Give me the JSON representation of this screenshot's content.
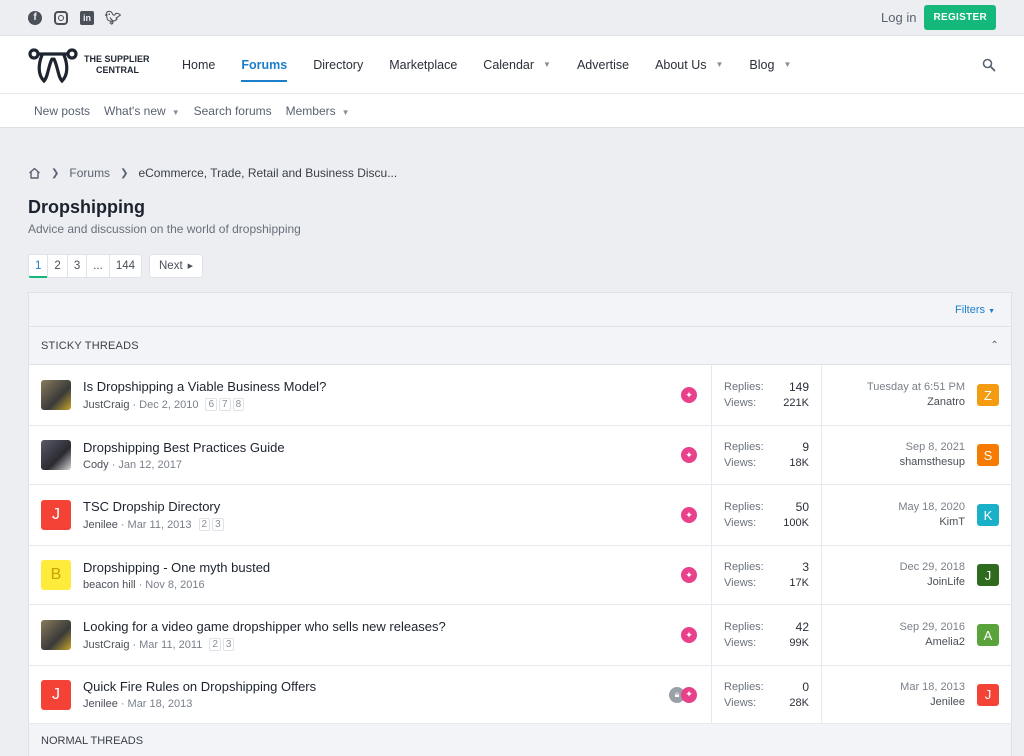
{
  "topbar": {
    "login": "Log in",
    "register": "REGISTER"
  },
  "logo": {
    "line1": "THE SUPPLIER",
    "line2": "CENTRAL"
  },
  "nav": [
    {
      "label": "Home"
    },
    {
      "label": "Forums"
    },
    {
      "label": "Directory"
    },
    {
      "label": "Marketplace"
    },
    {
      "label": "Calendar"
    },
    {
      "label": "Advertise"
    },
    {
      "label": "About Us"
    },
    {
      "label": "Blog"
    }
  ],
  "subnav": [
    {
      "label": "New posts"
    },
    {
      "label": "What's new"
    },
    {
      "label": "Search forums"
    },
    {
      "label": "Members"
    }
  ],
  "breadcrumb": {
    "forums": "Forums",
    "current": "eCommerce, Trade, Retail and Business Discu..."
  },
  "page": {
    "title": "Dropshipping",
    "description": "Advice and discussion on the world of dropshipping"
  },
  "pagination": {
    "pages": [
      "1",
      "2",
      "3",
      "...",
      "144"
    ],
    "next": "Next"
  },
  "filters": "Filters",
  "sticky_header": "STICKY THREADS",
  "normal_header": "NORMAL THREADS",
  "labels": {
    "replies": "Replies:",
    "views": "Views:"
  },
  "threads": [
    {
      "title": "Is Dropshipping a Viable Business Model?",
      "author": "JustCraig",
      "date": "Dec 2, 2010",
      "pages": [
        "6",
        "7",
        "8"
      ],
      "replies": "149",
      "views": "221K",
      "last_date": "Tuesday at 6:51 PM",
      "last_user": "Zanatro",
      "last_initial": "Z",
      "last_color": "#f39c12",
      "avatar_letter": "",
      "avatar_color": ""
    },
    {
      "title": "Dropshipping Best Practices Guide",
      "author": "Cody",
      "date": "Jan 12, 2017",
      "pages": [],
      "replies": "9",
      "views": "18K",
      "last_date": "Sep 8, 2021",
      "last_user": "shamsthesup",
      "last_initial": "S",
      "last_color": "#f57c00",
      "avatar_letter": "",
      "avatar_color": ""
    },
    {
      "title": "TSC Dropship Directory",
      "author": "Jenilee",
      "date": "Mar 11, 2013",
      "pages": [
        "2",
        "3"
      ],
      "replies": "50",
      "views": "100K",
      "last_date": "May 18, 2020",
      "last_user": "KimT",
      "last_initial": "K",
      "last_color": "#1ab0c8",
      "avatar_letter": "J",
      "avatar_color": "#f44336"
    },
    {
      "title": "Dropshipping - One myth busted",
      "author": "beacon hill",
      "date": "Nov 8, 2016",
      "pages": [],
      "replies": "3",
      "views": "17K",
      "last_date": "Dec 29, 2018",
      "last_user": "JoinLife",
      "last_initial": "J",
      "last_color": "#2e6b1e",
      "avatar_letter": "B",
      "avatar_color": "#ffeb3b"
    },
    {
      "title": "Looking for a video game dropshipper who sells new releases?",
      "author": "JustCraig",
      "date": "Mar 11, 2011",
      "pages": [
        "2",
        "3"
      ],
      "replies": "42",
      "views": "99K",
      "last_date": "Sep 29, 2016",
      "last_user": "Amelia2",
      "last_initial": "A",
      "last_color": "#5aa33a",
      "avatar_letter": "",
      "avatar_color": ""
    },
    {
      "title": "Quick Fire Rules on Dropshipping Offers",
      "author": "Jenilee",
      "date": "Mar 18, 2013",
      "pages": [],
      "replies": "0",
      "views": "28K",
      "last_date": "Mar 18, 2013",
      "last_user": "Jenilee",
      "last_initial": "J",
      "last_color": "#f44336",
      "avatar_letter": "J",
      "avatar_color": "#f44336"
    }
  ]
}
